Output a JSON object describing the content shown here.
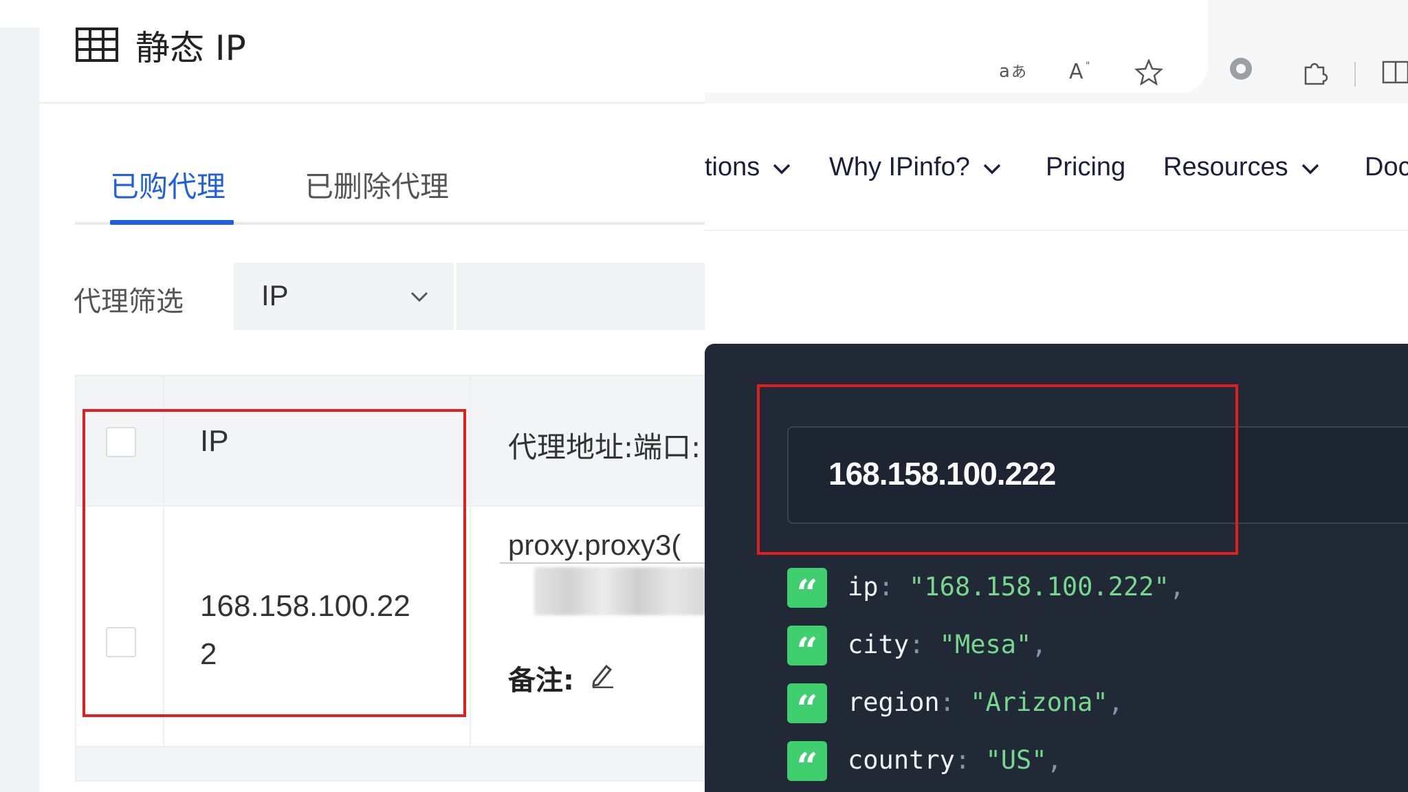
{
  "left": {
    "page_title": "静态 IP",
    "tabs": [
      {
        "label": "已购代理",
        "active": true
      },
      {
        "label": "已删除代理",
        "active": false
      }
    ],
    "filter": {
      "label": "代理筛选",
      "select_value": "IP"
    },
    "table": {
      "headers": [
        "IP",
        "代理地址:端口:"
      ],
      "row": {
        "ip": "168.158.100.222",
        "proxy": "proxy.proxy3(",
        "note_label": "备注:"
      }
    }
  },
  "right": {
    "toolbar_icons": [
      "read-aloud-icon",
      "text-size-icon",
      "favorite-star-icon",
      "extension-icon",
      "puzzle-icon",
      "split-screen-icon"
    ],
    "nav": [
      {
        "label": "tions",
        "dropdown": true
      },
      {
        "label": "Why IPinfo?",
        "dropdown": true
      },
      {
        "label": "Pricing",
        "dropdown": false
      },
      {
        "label": "Resources",
        "dropdown": true
      },
      {
        "label": "Doc",
        "dropdown": false
      }
    ],
    "lookup": {
      "ip_value": "168.158.100.222",
      "json_lines": [
        {
          "key": "ip",
          "value": "\"168.158.100.222\""
        },
        {
          "key": "city",
          "value": "\"Mesa\""
        },
        {
          "key": "region",
          "value": "\"Arizona\""
        },
        {
          "key": "country",
          "value": "\"US\""
        }
      ]
    }
  },
  "colors": {
    "accent_blue": "#1f5fe0",
    "highlight_red": "#e11d1d",
    "dark_card": "#212937",
    "json_green": "#76d88c",
    "badge_green": "#3fcf6e"
  }
}
